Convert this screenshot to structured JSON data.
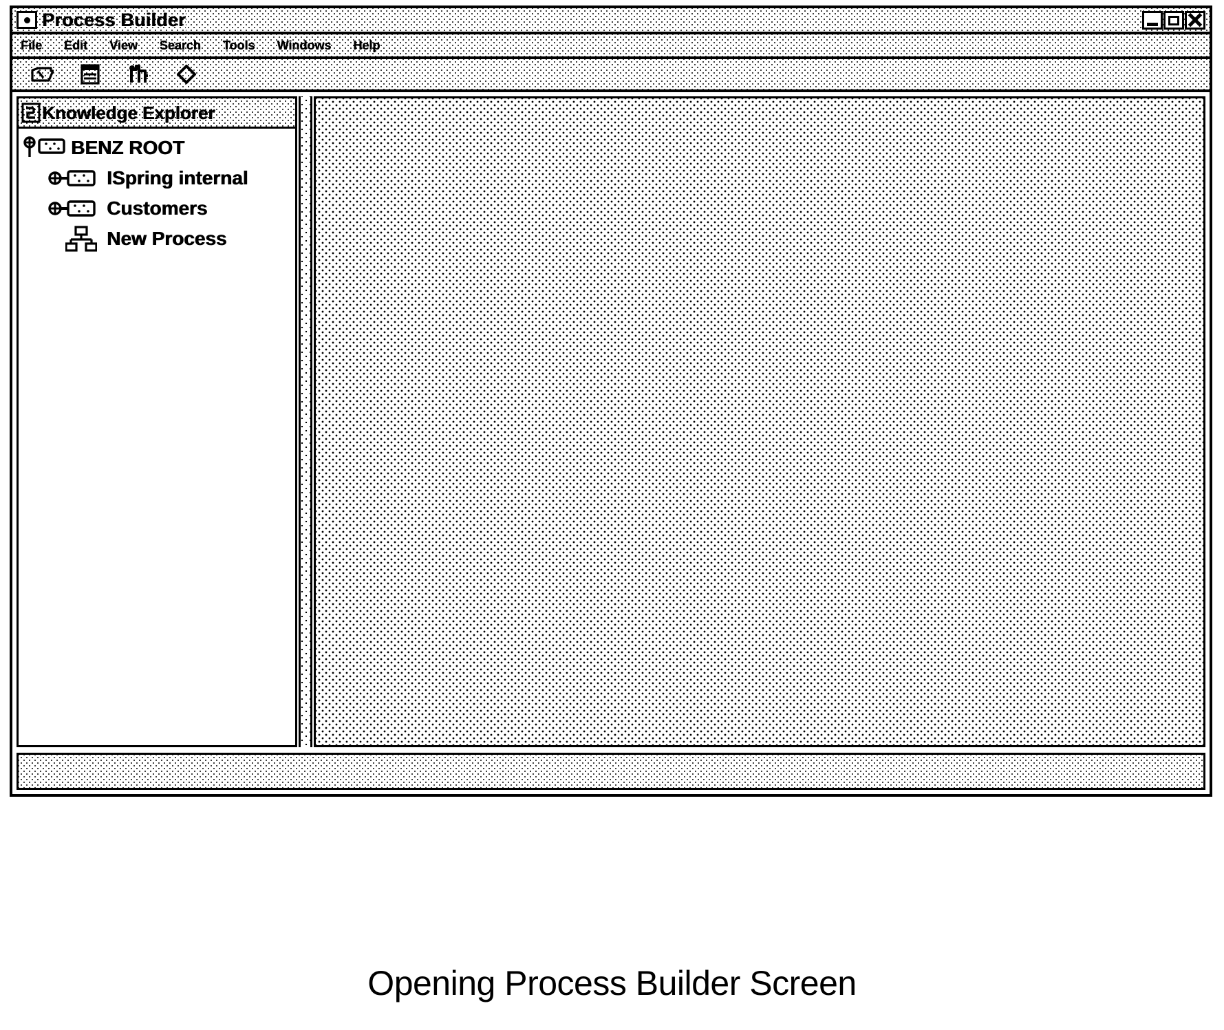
{
  "window": {
    "title": "Process Builder",
    "icon": "app-window-icon",
    "controls": [
      {
        "name": "minimize",
        "label": "Minimize"
      },
      {
        "name": "maximize",
        "label": "Maximize"
      },
      {
        "name": "close",
        "label": "Close"
      }
    ]
  },
  "menu": {
    "items": [
      {
        "label": "File"
      },
      {
        "label": "Edit"
      },
      {
        "label": "View"
      },
      {
        "label": "Search"
      },
      {
        "label": "Tools"
      },
      {
        "label": "Windows"
      },
      {
        "label": "Help"
      }
    ]
  },
  "toolbar": {
    "buttons": [
      {
        "name": "open-folder-icon",
        "label": "Open"
      },
      {
        "name": "document-list-icon",
        "label": "Document"
      },
      {
        "name": "key-icon",
        "label": "Key"
      },
      {
        "name": "diamond-icon",
        "label": "Decision"
      }
    ]
  },
  "explorer": {
    "title": "Knowledge Explorer",
    "header_icon": "explorer-panel-icon",
    "tree": [
      {
        "label": "BENZ ROOT",
        "depth": 0,
        "icon": "key-node-icon",
        "expander": "expanded"
      },
      {
        "label": "ISpring internal",
        "depth": 1,
        "icon": "key-node-icon",
        "expander": "collapsed"
      },
      {
        "label": "Customers",
        "depth": 1,
        "icon": "key-node-icon",
        "expander": "collapsed"
      },
      {
        "label": "New Process",
        "depth": 2,
        "icon": "process-hierarchy-icon",
        "expander": "none"
      }
    ]
  },
  "canvas": {
    "content": ""
  },
  "status_bar": {
    "text": ""
  },
  "caption": {
    "text": "Opening Process Builder Screen"
  },
  "colors": {
    "ink": "#000000",
    "paper": "#ffffff"
  }
}
